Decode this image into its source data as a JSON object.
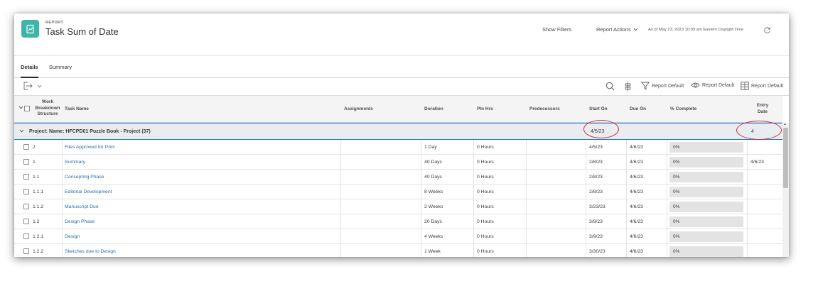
{
  "header": {
    "overline": "REPORT",
    "title": "Task Sum of Date",
    "show_filters": "Show Filters",
    "report_actions": "Report Actions",
    "as_of": "As of May 23, 2023 10:09 am Eastern Daylight Time"
  },
  "tabs": [
    "Details",
    "Summary"
  ],
  "toolbar": {
    "filter_label": "Report Default",
    "view_label": "Report Default",
    "grouping_label": "Report Default"
  },
  "columns": {
    "wbs": "Work Breakdown Structure",
    "task_name": "Task Name",
    "assignments": "Assignments",
    "duration": "Duration",
    "pln_hrs": "Pln Hrs",
    "predecessors": "Predecessors",
    "start_on": "Start On",
    "due_on": "Due On",
    "pct_complete": "% Complete",
    "entry_date": "Entry Date"
  },
  "group": {
    "label": "Project: Name: HFCPD01 Puzzle Book - Project (37)",
    "start_on": "4/5/23",
    "entry_date": "4"
  },
  "rows": [
    {
      "wbs": "2",
      "task": "Files Approved for Print",
      "duration": "1 Day",
      "pln_hrs": "0 Hours",
      "start": "4/5/23",
      "due": "4/6/23",
      "pct": "0%",
      "entry": ""
    },
    {
      "wbs": "1",
      "task": "Summary",
      "duration": "40 Days",
      "pln_hrs": "0 Hours",
      "start": "2/8/23",
      "due": "4/6/23",
      "pct": "0%",
      "entry": "4/6/23"
    },
    {
      "wbs": "1.1",
      "task": "Concepting Phase",
      "duration": "40 Days",
      "pln_hrs": "0 Hours",
      "start": "2/8/23",
      "due": "4/6/23",
      "pct": "0%",
      "entry": ""
    },
    {
      "wbs": "1.1.1",
      "task": "Editorial Development",
      "duration": "8 Weeks",
      "pln_hrs": "0 Hours",
      "start": "2/8/23",
      "due": "4/6/23",
      "pct": "0%",
      "entry": ""
    },
    {
      "wbs": "1.1.2",
      "task": "Manuscript Due",
      "duration": "2 Weeks",
      "pln_hrs": "0 Hours",
      "start": "3/23/23",
      "due": "4/6/23",
      "pct": "0%",
      "entry": ""
    },
    {
      "wbs": "1.2",
      "task": "Design Phase",
      "duration": "20 Days",
      "pln_hrs": "0 Hours",
      "start": "3/9/23",
      "due": "4/6/23",
      "pct": "0%",
      "entry": ""
    },
    {
      "wbs": "1.2.1",
      "task": "Design",
      "duration": "4 Weeks",
      "pln_hrs": "0 Hours",
      "start": "3/9/23",
      "due": "4/6/23",
      "pct": "0%",
      "entry": ""
    },
    {
      "wbs": "1.2.2",
      "task": "Sketches due to Design",
      "duration": "1 Week",
      "pln_hrs": "0 Hours",
      "start": "3/30/23",
      "due": "4/6/23",
      "pct": "0%",
      "entry": ""
    }
  ],
  "colors": {
    "accent": "#3db5a7",
    "link": "#2b6cb0",
    "highlight": "#d0313b",
    "group_border": "#1473e6"
  }
}
